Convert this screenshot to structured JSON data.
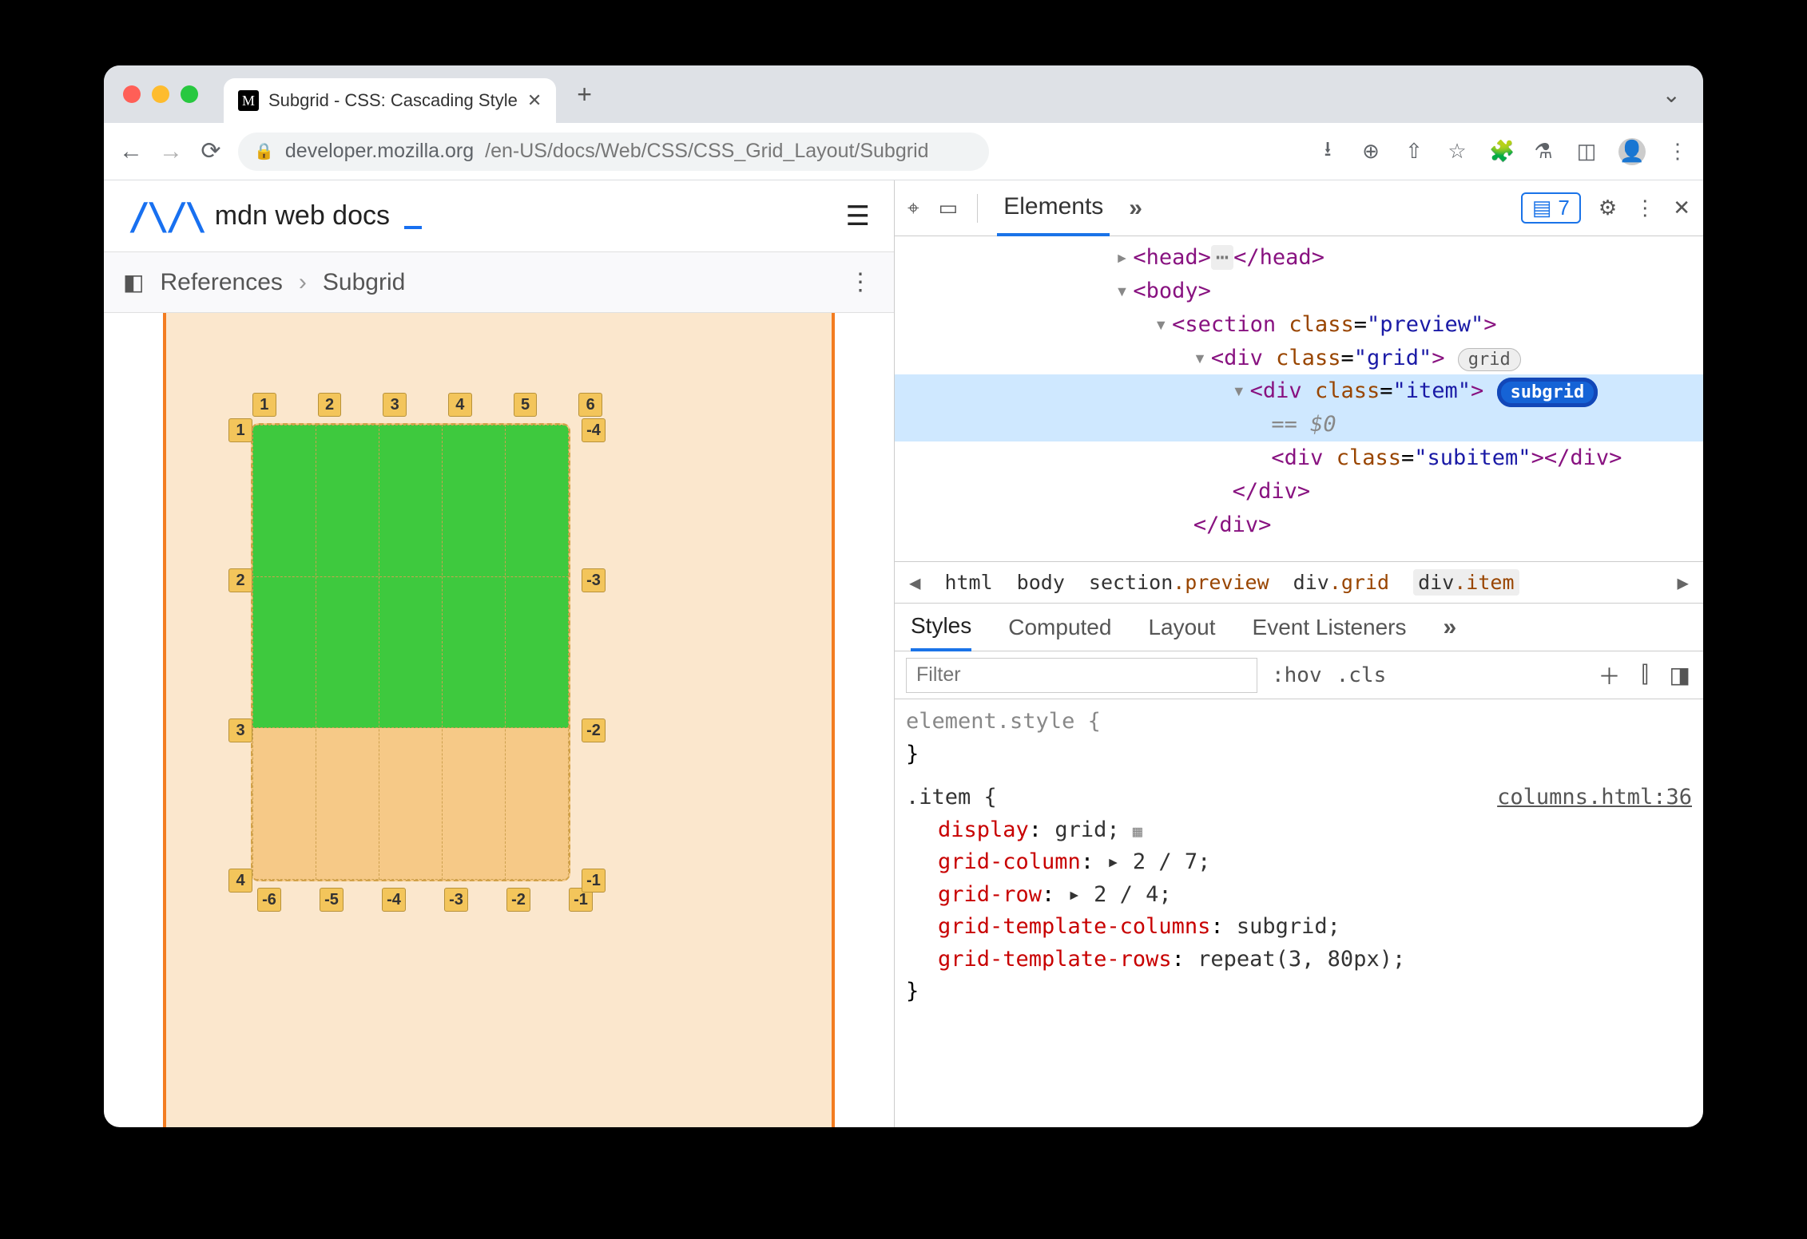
{
  "browser": {
    "tab_title": "Subgrid - CSS: Cascading Style",
    "url_host": "developer.mozilla.org",
    "url_path": "/en-US/docs/Web/CSS/CSS_Grid_Layout/Subgrid"
  },
  "mdn": {
    "logo_text": "mdn web docs",
    "breadcrumb_root": "References",
    "breadcrumb_current": "Subgrid"
  },
  "grid_labels": {
    "top": [
      "1",
      "2",
      "3",
      "4",
      "5",
      "6"
    ],
    "left": [
      "1",
      "2",
      "3",
      "4"
    ],
    "right": [
      "-4",
      "-3",
      "-2",
      "-1"
    ],
    "bottom": [
      "-6",
      "-5",
      "-4",
      "-3",
      "-2",
      "-1"
    ]
  },
  "devtools": {
    "panel_tab": "Elements",
    "issues_count": "7",
    "dom": {
      "head": "<head>…</head>",
      "body_open": "<body>",
      "section_open": "<section class=\"preview\">",
      "grid_open": "<div class=\"grid\">",
      "grid_badge": "grid",
      "item_open": "<div class=\"item\">",
      "subgrid_badge": "subgrid",
      "eq0": "== $0",
      "subitem": "<div class=\"subitem\"></div>",
      "div_close": "</div>",
      "div_close2": "</div>"
    },
    "crumbs": [
      "html",
      "body",
      "section.preview",
      "div.grid",
      "div.item"
    ],
    "style_tabs": [
      "Styles",
      "Computed",
      "Layout",
      "Event Listeners"
    ],
    "filter_placeholder": "Filter",
    "hov": ":hov",
    "cls": ".cls",
    "styles": {
      "element_style": "element.style {",
      "brace_close": "}",
      "item_selector": ".item {",
      "src": "columns.html:36",
      "rules": [
        {
          "prop": "display",
          "val": "grid;"
        },
        {
          "prop": "grid-column",
          "val": "▸ 2 / 7;"
        },
        {
          "prop": "grid-row",
          "val": "▸ 2 / 4;"
        },
        {
          "prop": "grid-template-columns",
          "val": "subgrid;"
        },
        {
          "prop": "grid-template-rows",
          "val": "repeat(3, 80px);"
        }
      ]
    }
  }
}
